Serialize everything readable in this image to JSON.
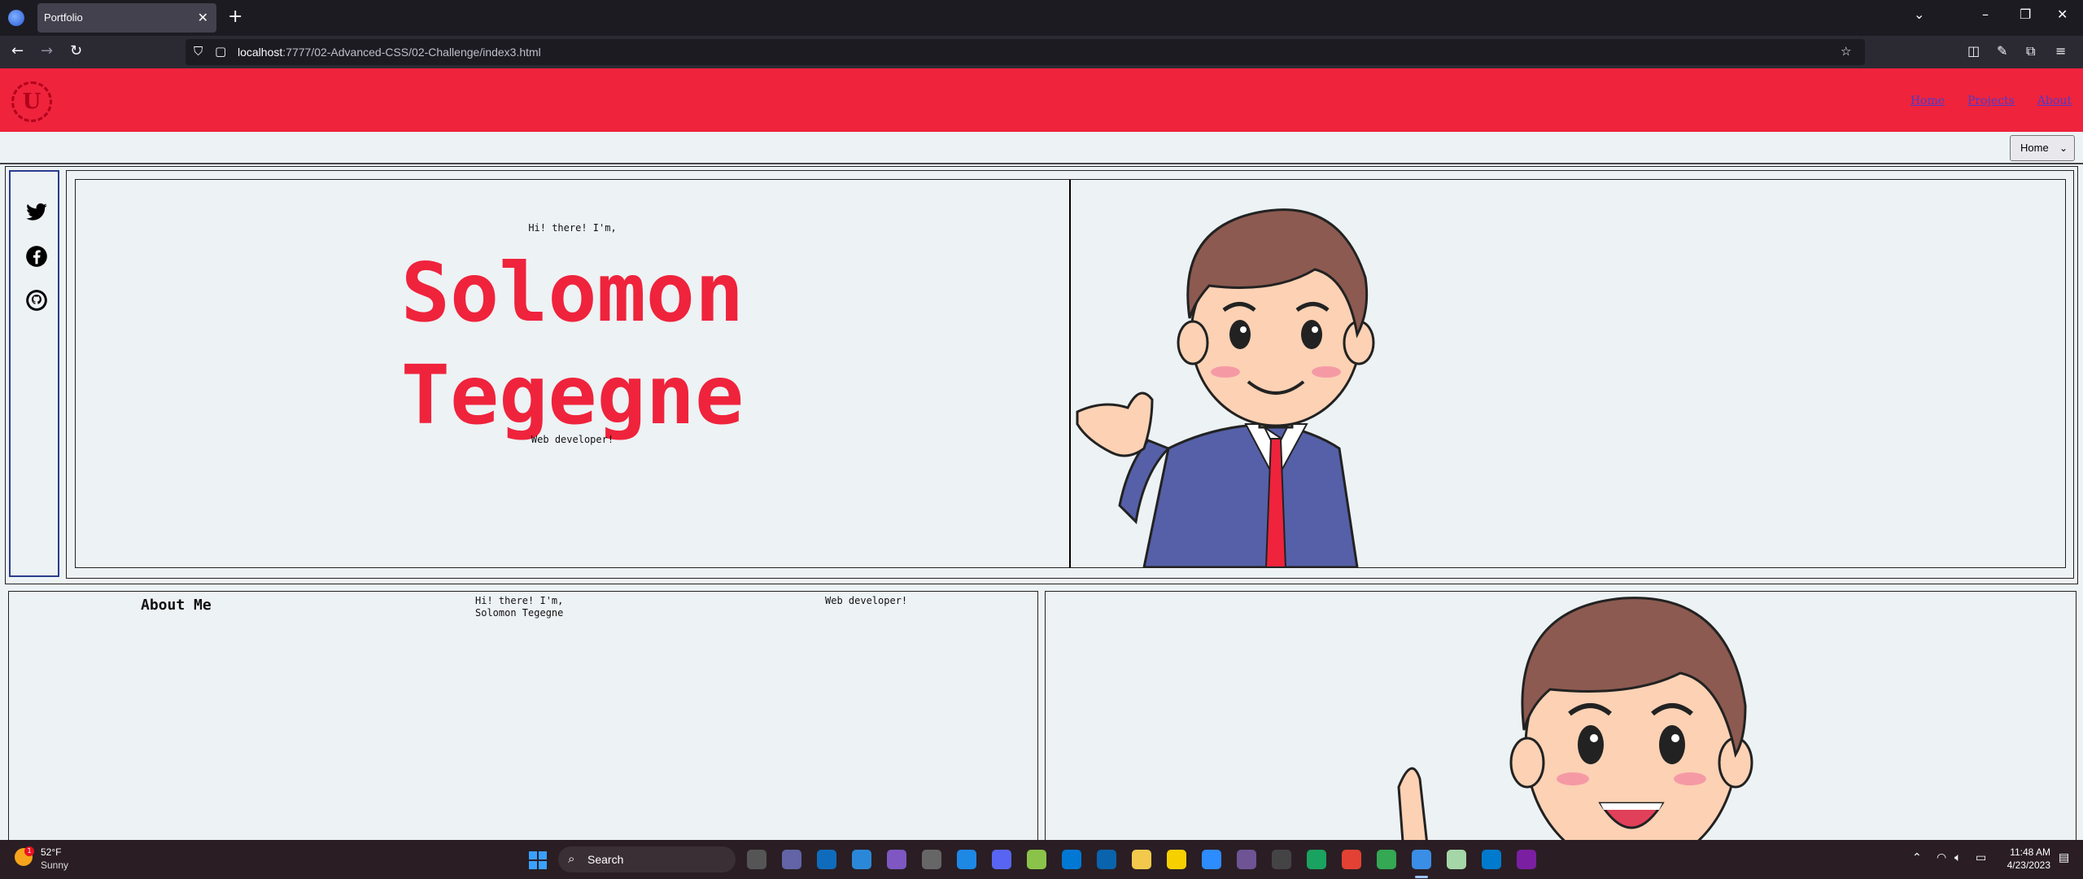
{
  "browser": {
    "tab_title": "Portfolio",
    "tab_close": "✕",
    "new_tab": "+",
    "url_host": "localhost",
    "url_path": ":7777/02-Advanced-CSS/02-Challenge/index3.html"
  },
  "site": {
    "logo": "U",
    "nav": [
      "Home",
      "Projects",
      "About"
    ],
    "select_value": "Home"
  },
  "hero": {
    "greeting": "Hi! there! I'm,",
    "name_line1": "Solomon",
    "name_line2": "Tegegne",
    "role": "Web developer!"
  },
  "social": [
    "twitter-icon",
    "facebook-icon",
    "github-icon"
  ],
  "about": {
    "title": "About Me",
    "greeting_line1": "Hi! there! I'm,",
    "greeting_line2": "Solomon Tegegne",
    "role": "Web developer!"
  },
  "taskbar": {
    "temperature": "52°F",
    "condition": "Sunny",
    "weather_badge": "1",
    "search_label": "Search",
    "time": "11:48 AM",
    "date": "4/23/2023"
  },
  "colors": {
    "accent": "#ef233c",
    "page_bg": "#edf2f4",
    "social_border": "#2a3c8f"
  }
}
